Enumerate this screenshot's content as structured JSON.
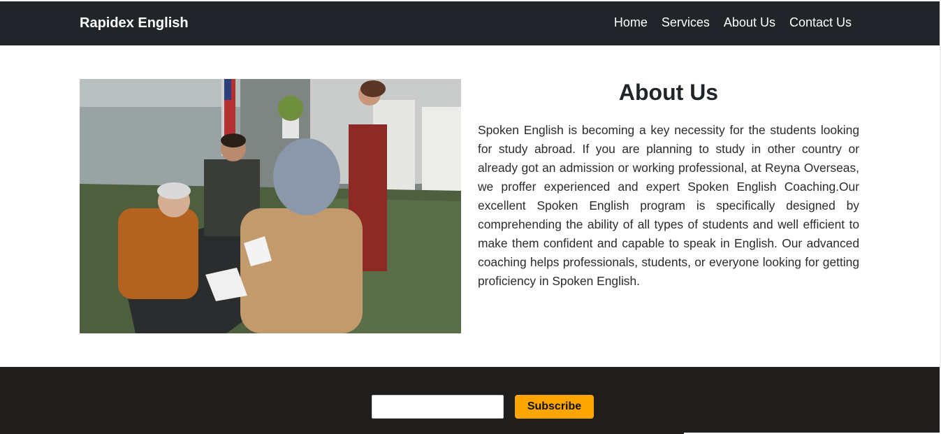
{
  "navbar": {
    "brand": "Rapidex English",
    "links": [
      "Home",
      "Services",
      "About Us",
      "Contact Us"
    ]
  },
  "about": {
    "title": "About Us",
    "body": "Spoken English is becoming a key necessity for the students looking for study abroad. If you are planning to study in other country or already got an admission or working professional, at Reyna Overseas, we proffer experienced and expert Spoken English Coaching.Our excellent Spoken English program is specifically designed by comprehending the ability of all types of students and well efficient to make them confident and capable to speak in English. Our advanced coaching helps professionals, students, or everyone looking for getting proficiency in Spoken English."
  },
  "footer": {
    "email_placeholder": "",
    "subscribe_label": "Subscribe"
  },
  "colors": {
    "navbar_bg": "#212529",
    "footer_bg": "#1f1e1d",
    "accent": "#ffa500"
  }
}
